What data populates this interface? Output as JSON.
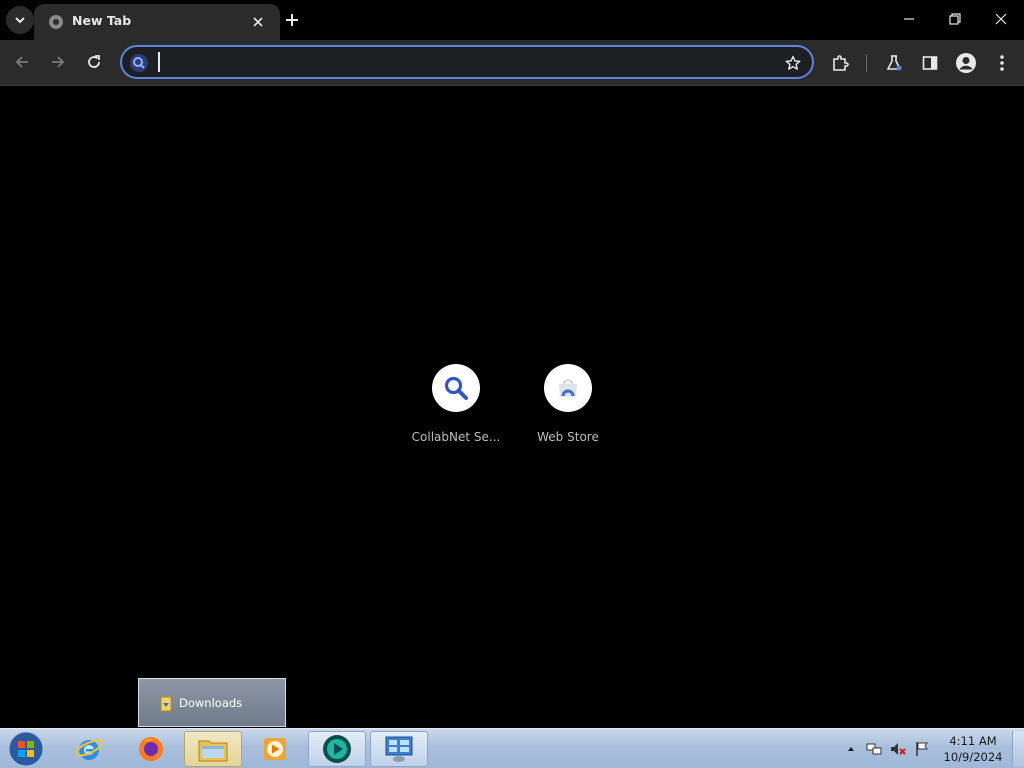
{
  "browser": {
    "tab": {
      "title": "New Tab"
    },
    "omnibox": {
      "value": "",
      "placeholder": ""
    }
  },
  "shortcuts": [
    {
      "label": "CollabNet Se...",
      "icon": "search-icon"
    },
    {
      "label": "Web Store",
      "icon": "web-store-icon"
    }
  ],
  "taskbar": {
    "popup": {
      "label": "Downloads"
    },
    "items": [
      {
        "name": "internet-explorer",
        "icon": "ie-icon"
      },
      {
        "name": "firefox",
        "icon": "firefox-icon"
      },
      {
        "name": "file-explorer",
        "icon": "folder-icon",
        "state": "active"
      },
      {
        "name": "media-player",
        "icon": "media-player-icon"
      },
      {
        "name": "chrome-like",
        "icon": "app-icon",
        "state": "open"
      },
      {
        "name": "control-panel",
        "icon": "control-panel-icon",
        "state": "open"
      }
    ],
    "clock": {
      "time": "4:11 AM",
      "date": "10/9/2024"
    }
  },
  "colors": {
    "accent": "#5a84dd",
    "toolbar_bg": "#2b2b2b",
    "content_bg": "#000000"
  }
}
